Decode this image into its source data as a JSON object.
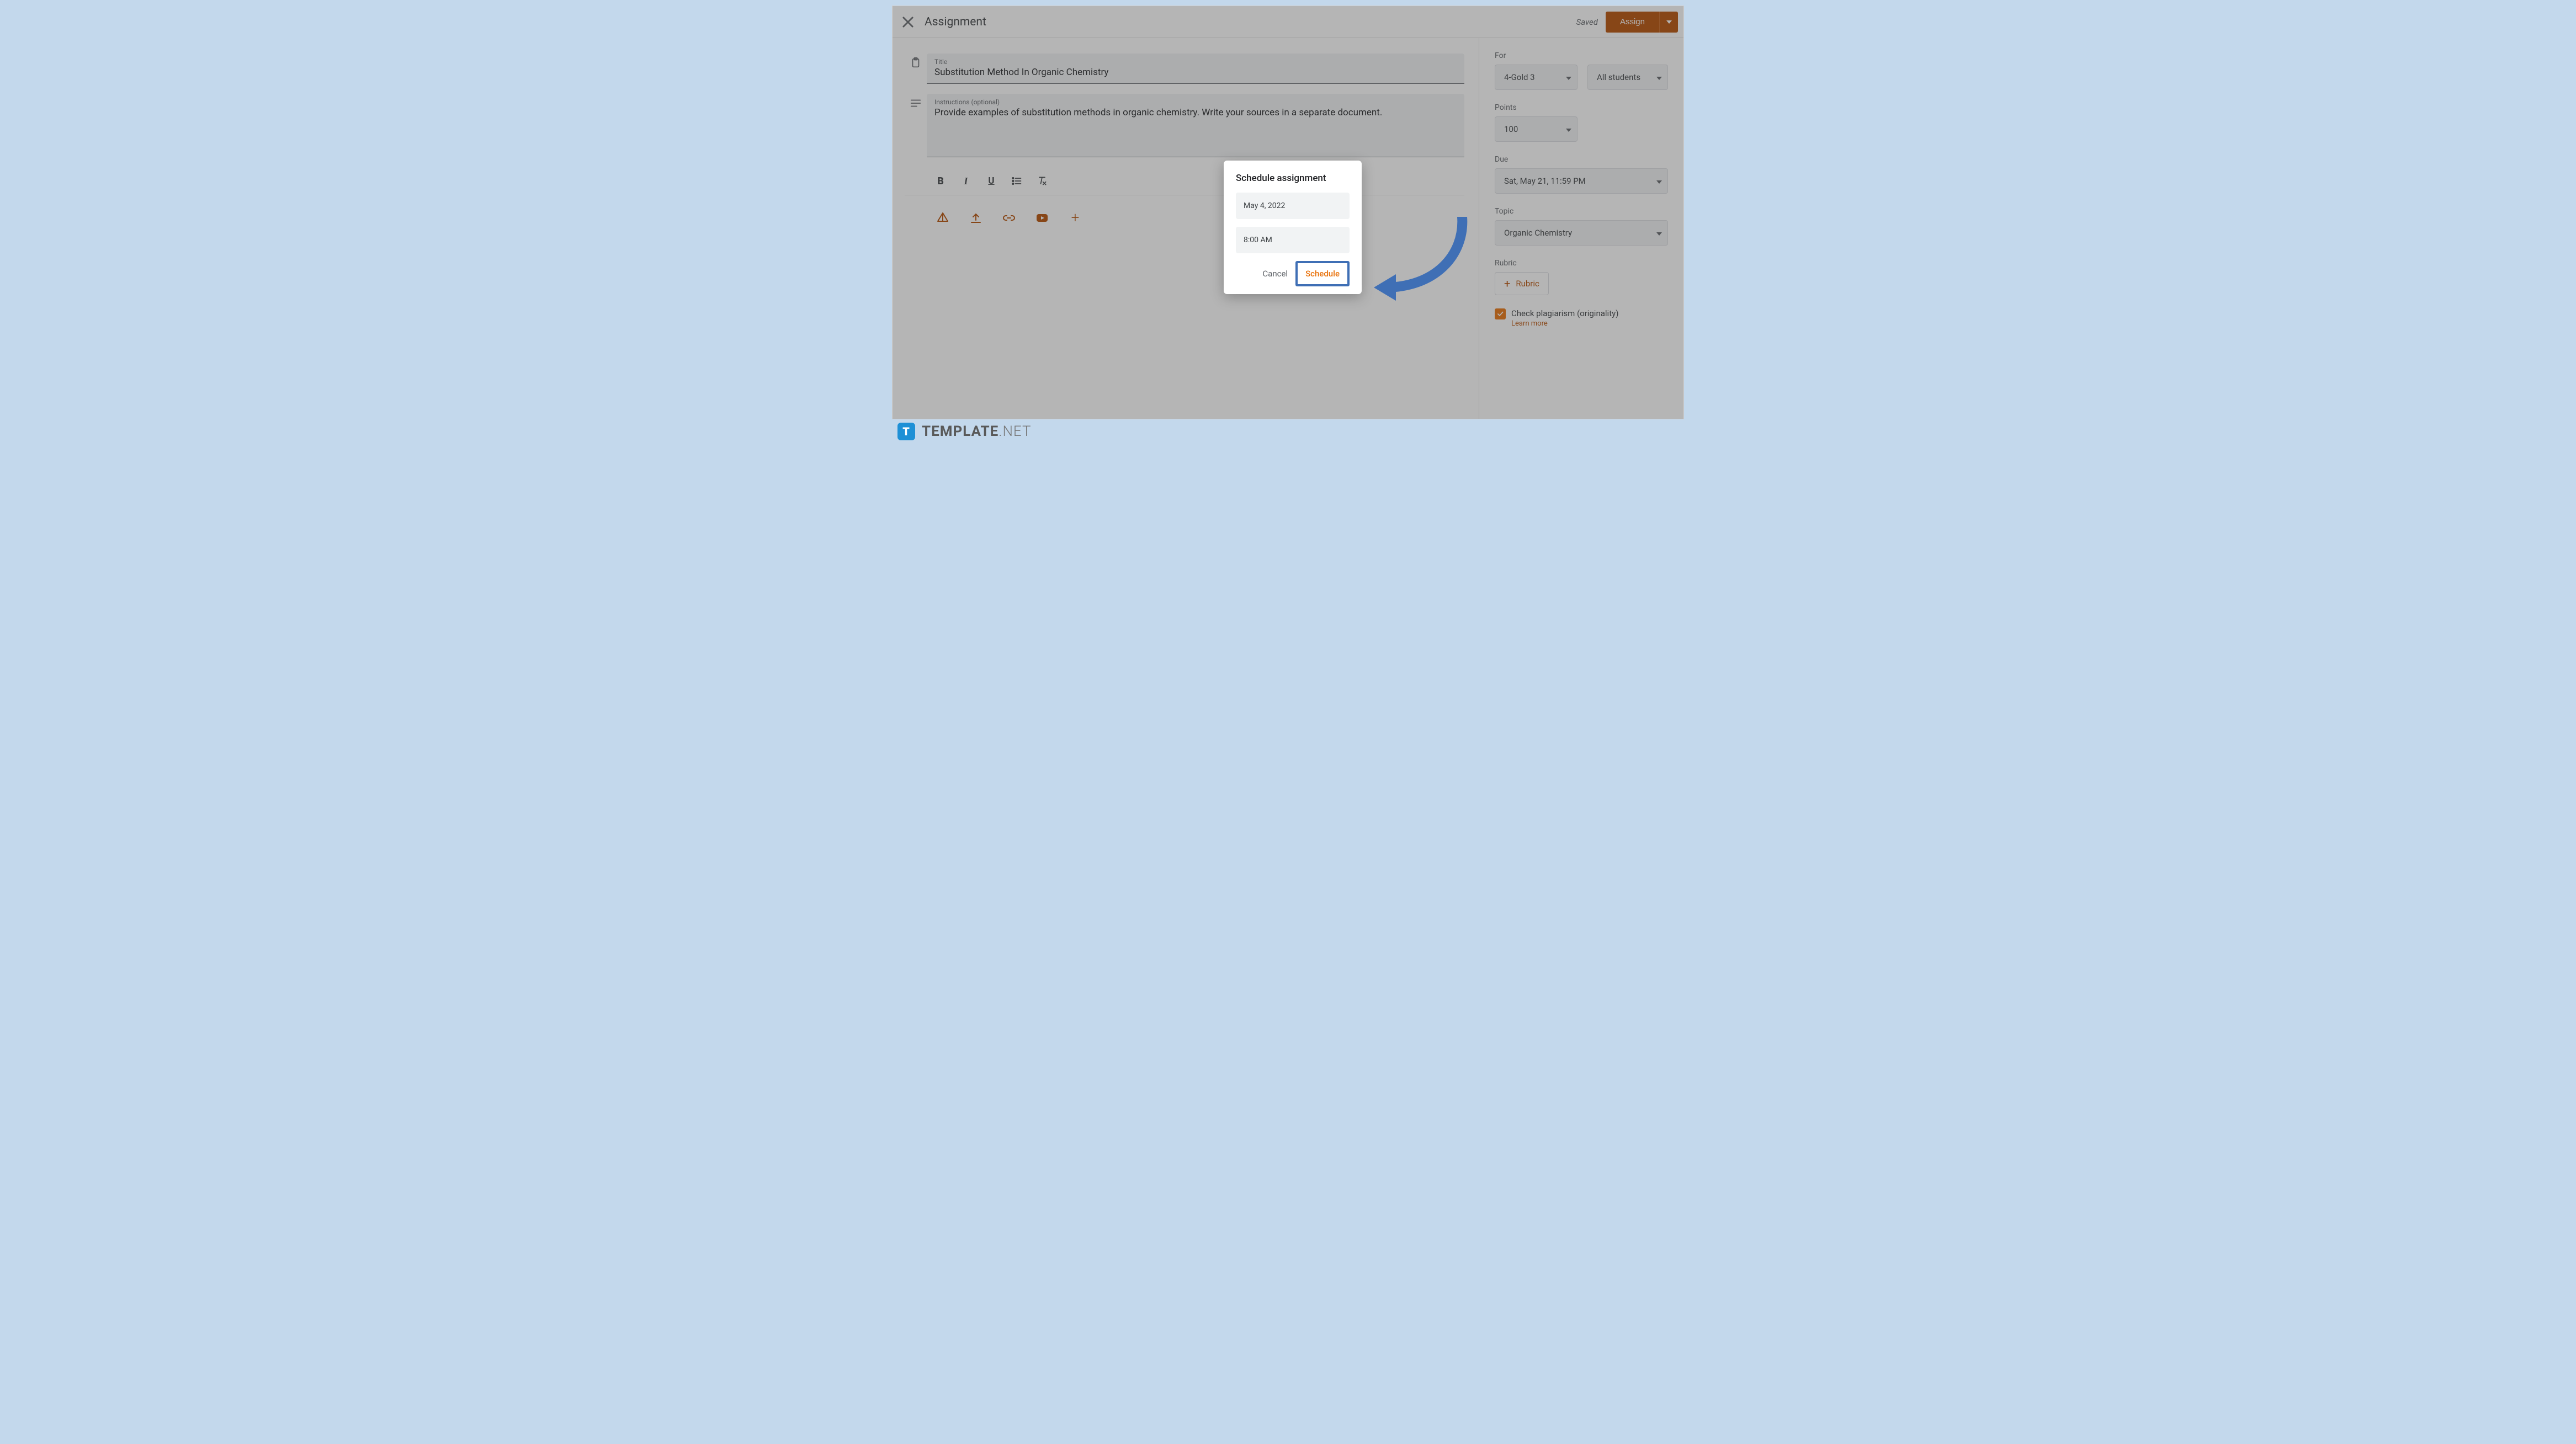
{
  "header": {
    "page_title": "Assignment",
    "saved_label": "Saved",
    "assign_button_label": "Assign"
  },
  "main": {
    "title_field_label": "Title",
    "title_value": "Substitution Method In Organic Chemistry",
    "instructions_field_label": "Instructions (optional)",
    "instructions_value": "Provide examples of substitution methods in organic chemistry. Write your sources in a separate document."
  },
  "formatting": {
    "bold": "B",
    "italic": "I",
    "underline": "U"
  },
  "sidebar": {
    "for_label": "For",
    "class_value": "4-Gold 3",
    "students_value": "All students",
    "points_label": "Points",
    "points_value": "100",
    "due_label": "Due",
    "due_value": "Sat, May 21, 11:59 PM",
    "topic_label": "Topic",
    "topic_value": "Organic Chemistry",
    "rubric_label": "Rubric",
    "rubric_button_label": "Rubric",
    "plagiarism_label": "Check plagiarism (originality)",
    "plagiarism_link": "Learn more"
  },
  "dialog": {
    "title": "Schedule assignment",
    "date_value": "May 4, 2022",
    "time_value": "8:00 AM",
    "cancel_label": "Cancel",
    "schedule_label": "Schedule"
  },
  "footer": {
    "brand_bold": "TEMPLATE",
    "brand_thin": ".NET",
    "badge": "T"
  },
  "colors": {
    "accent_orange": "#e8710a",
    "assign_orange": "#b54c00",
    "callout_blue": "#3f6fb5",
    "page_bg": "#c3d8ec"
  }
}
